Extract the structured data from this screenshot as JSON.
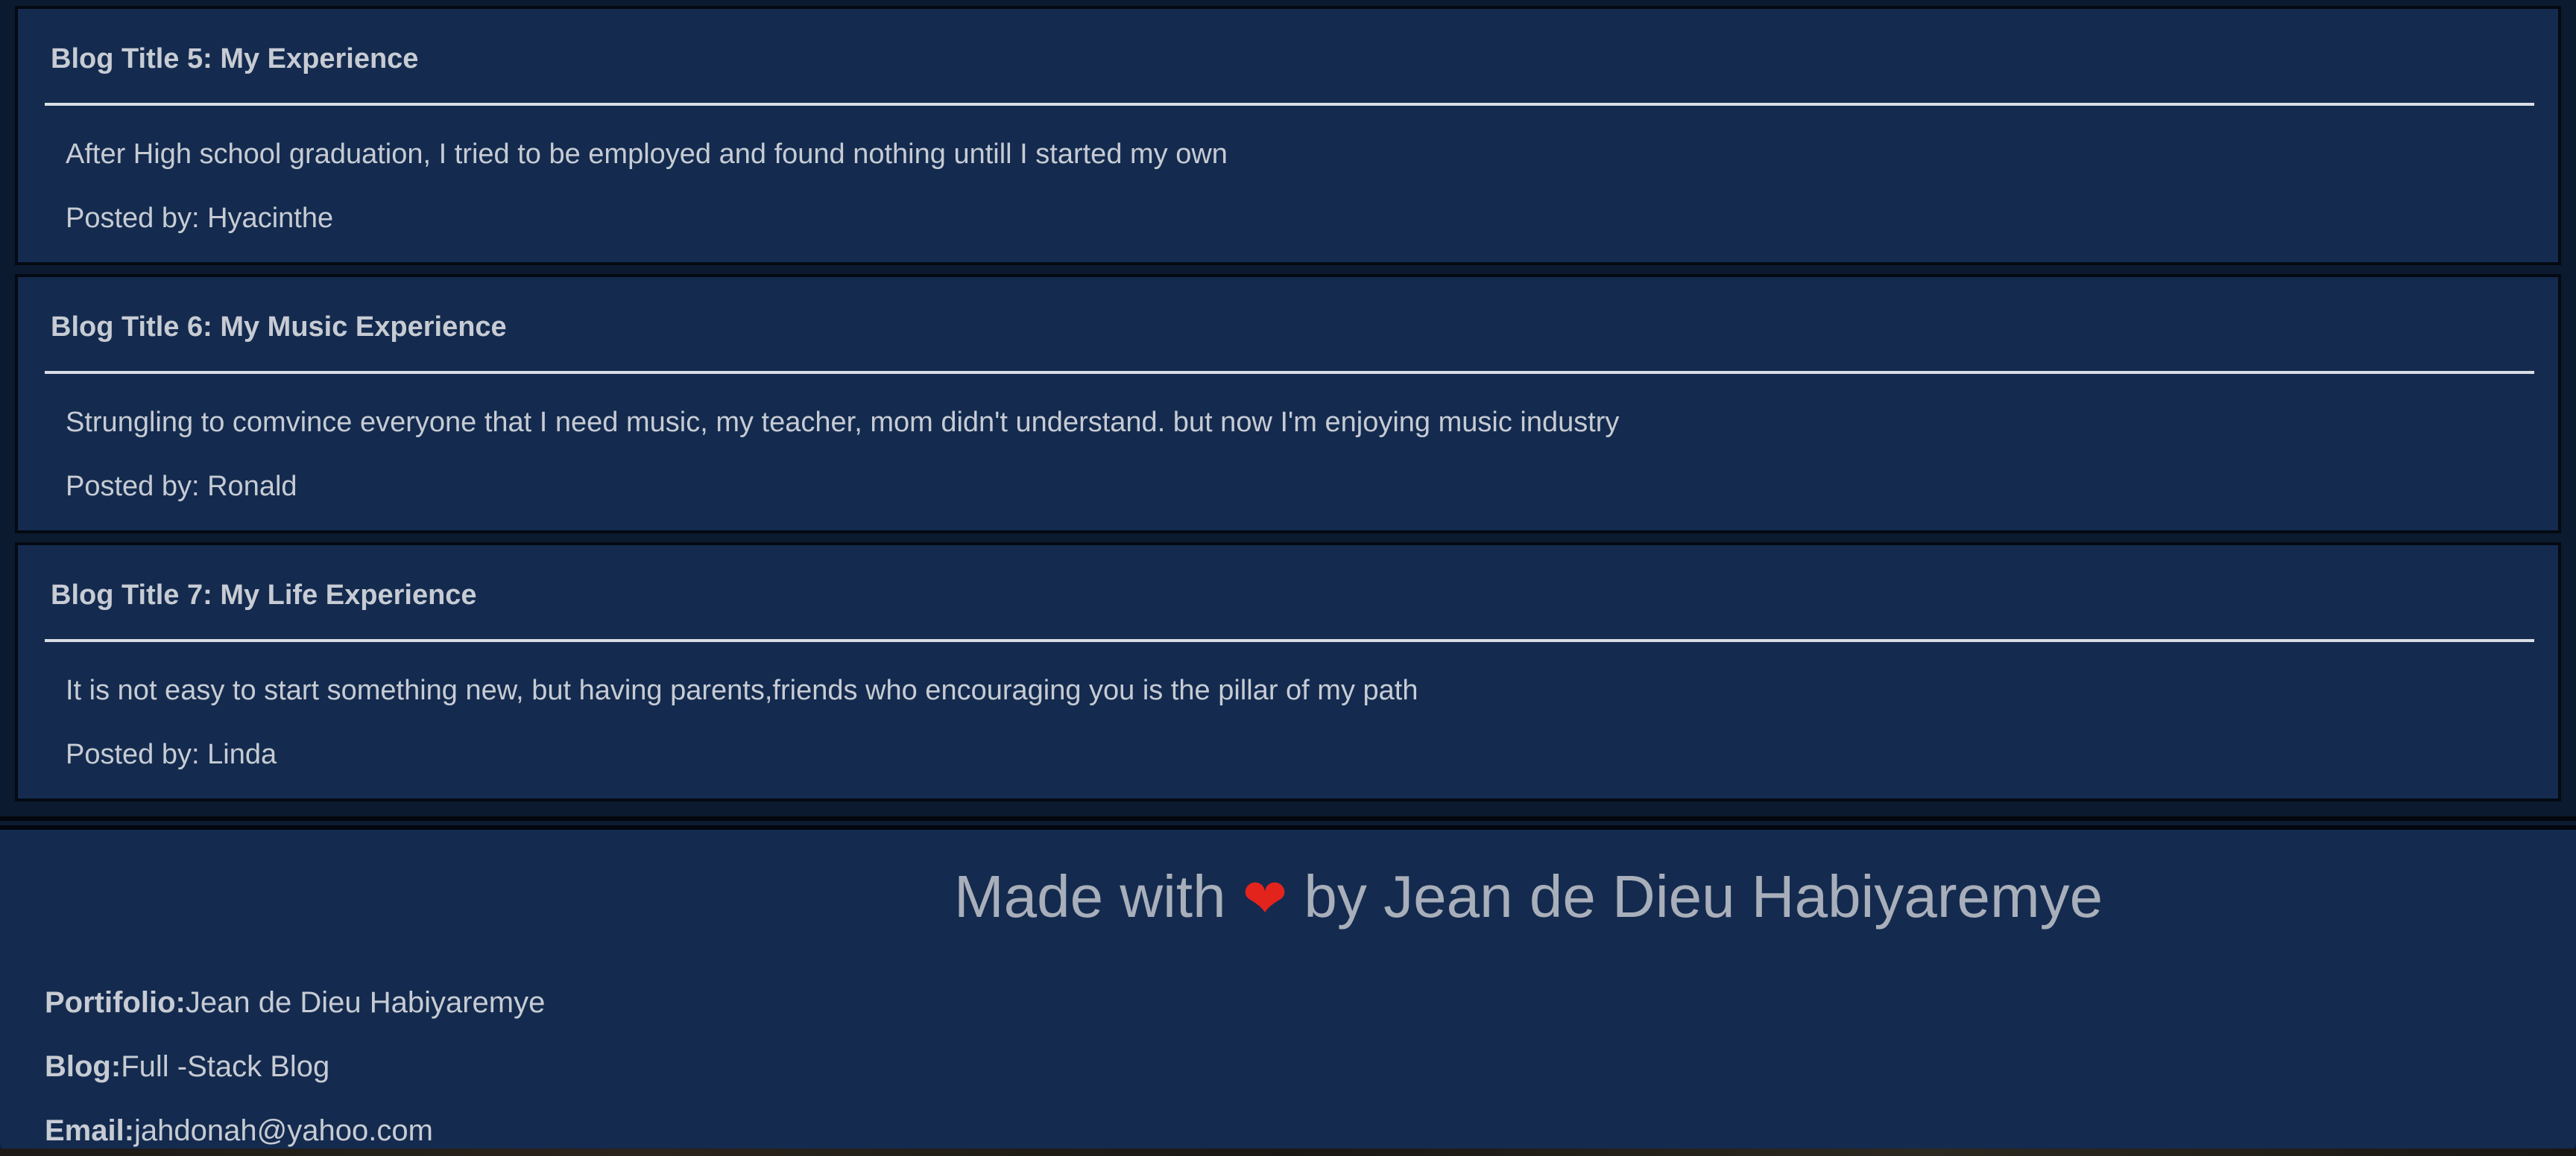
{
  "posts": [
    {
      "title": "Blog Title 5: My Experience",
      "body": "After High school graduation, I tried to be employed and found nothing untill I started my own",
      "author": "Posted by: Hyacinthe"
    },
    {
      "title": "Blog Title 6: My Music Experience",
      "body": "Strungling to comvince everyone that I need music, my teacher, mom didn't understand. but now I'm enjoying music industry",
      "author": "Posted by: Ronald"
    },
    {
      "title": "Blog Title 7: My Life Experience",
      "body": "It is not easy to start something new, but having parents,friends who encouraging you is the pillar of my path",
      "author": "Posted by: Linda"
    }
  ],
  "footer": {
    "credit_prefix": "Made with",
    "heart": "❤",
    "credit_suffix": "by Jean de Dieu Habiyaremye",
    "portfolio_label": "Portifolio:",
    "portfolio_value": "Jean de Dieu Habiyaremye",
    "blog_label": "Blog:",
    "blog_value": "Full -Stack Blog",
    "email_label": "Email:",
    "email_value": "jahdonah@yahoo.com"
  },
  "colors": {
    "card_background": "#142b4f",
    "text": "#c7cbd3",
    "heart": "#e3241d"
  }
}
